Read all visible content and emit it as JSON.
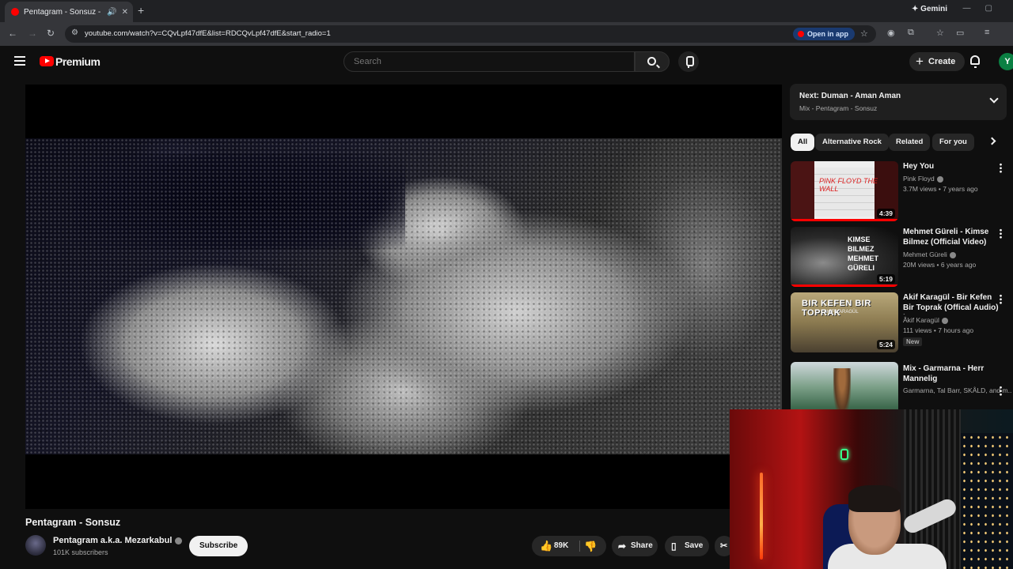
{
  "browser": {
    "tab_title": "Pentagram - Sonsuz - YouT",
    "gemini_label": "Gemini",
    "url": "youtube.com/watch?v=CQvLpf47dfE&list=RDCQvLpf47dfE&start_radio=1",
    "open_app_label": "Open in app"
  },
  "header": {
    "logo_text": "Premium",
    "search_placeholder": "Search",
    "create_label": "Create",
    "avatar_initial": "Y"
  },
  "video": {
    "title": "Pentagram - Sonsuz",
    "channel": "Pentagram a.k.a. Mezarkabul",
    "subscribers": "101K subscribers",
    "subscribe_label": "Subscribe",
    "likes": "89K",
    "share_label": "Share",
    "save_label": "Save"
  },
  "up_next": {
    "title": "Next: Duman - Aman Aman",
    "subtitle": "Mix - Pentagram - Sonsuz"
  },
  "chips": [
    "All",
    "Alternative Rock",
    "Related",
    "For you"
  ],
  "recommendations": [
    {
      "title": "Hey You",
      "channel": "Pink Floyd",
      "meta": "3.7M views • 7 years ago",
      "duration": "4:39",
      "thumb_text": "PINK FLOYD THE WALL"
    },
    {
      "title": "Mehmet Güreli - Kimse Bilmez (Official Video)",
      "channel": "Mehmet Güreli",
      "meta": "20M views • 6 years ago",
      "duration": "5:19",
      "thumb_text": "KIMSE BILMEZ MEHMET GÜRELI"
    },
    {
      "title": "Akif Karagül - Bir Kefen Bir Toprak (Offical Audio) | ...",
      "channel": "Âkif Karagül",
      "meta": "111 views • 7 hours ago",
      "duration": "5:24",
      "badge": "New",
      "thumb_text": "BIR KEFEN BIR TOPRAK",
      "thumb_sub": "AKIF KARAGÜL"
    },
    {
      "title": "Mix - Garmarna - Herr Mannelig",
      "meta": "Garmarna, Tal Barr, SKÅLD, and m..."
    }
  ]
}
